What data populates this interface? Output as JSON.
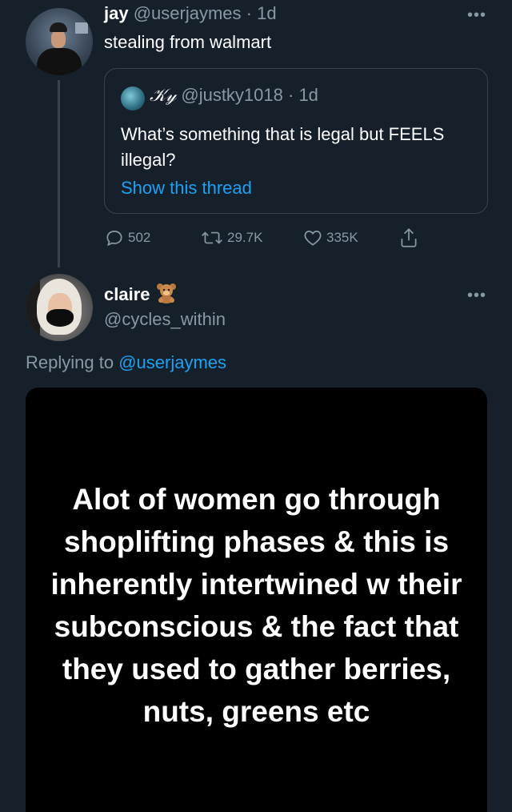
{
  "tweet1": {
    "name": "jay",
    "handle": "@userjaymes",
    "separator": " · ",
    "time": "1d",
    "text": "stealing from walmart",
    "quote": {
      "name": "𝒦𝓎",
      "handle": "@justky1018",
      "separator": " · ",
      "time": "1d",
      "text": "What’s something that is legal but FEELS illegal?",
      "link": "Show this thread"
    },
    "actions": {
      "replies": "502",
      "retweets": "29.7K",
      "likes": "335K"
    }
  },
  "tweet2": {
    "name": "claire",
    "handle": "@cycles_within",
    "replying_prefix": "Replying to ",
    "replying_to": "@userjaymes",
    "media_text": "Alot of women go through shoplifting phases & this is inherently intertwined w their subconscious & the fact that they used to gather berries, nuts, greens etc"
  },
  "icons": {
    "more": "more-dots-icon",
    "reply": "reply-icon",
    "retweet": "retweet-icon",
    "like": "heart-icon",
    "share": "share-icon",
    "emoji": "teddy-bear-icon"
  },
  "colors": {
    "background": "#15202b",
    "secondary_text": "#8899a6",
    "link": "#1da1f2",
    "border": "#38444d"
  }
}
